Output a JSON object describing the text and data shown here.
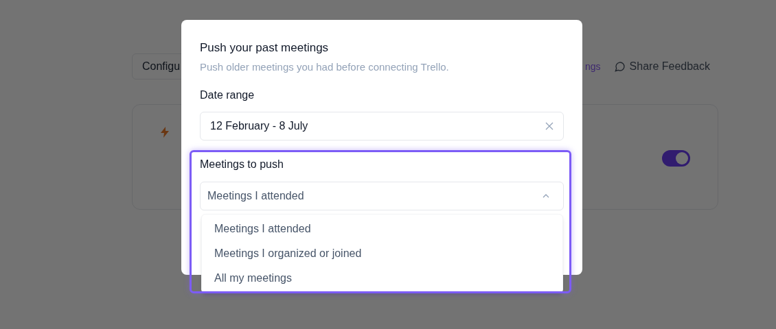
{
  "background_page": {
    "configure_button": "Configu",
    "settings_link": "ngs",
    "feedback_link": "Share Feedback",
    "card": {
      "toggle": {
        "on": true
      }
    }
  },
  "dialog": {
    "title": "Push your past meetings",
    "subtitle": "Push older meetings you had before connecting Trello.",
    "date_range": {
      "label": "Date range",
      "value": "12 February - 8 July"
    },
    "meetings_to_push": {
      "label": "Meetings to push",
      "value": "Meetings I attended",
      "expanded": true,
      "options": [
        "Meetings I attended",
        "Meetings I organized or joined",
        "All my meetings"
      ]
    }
  }
}
